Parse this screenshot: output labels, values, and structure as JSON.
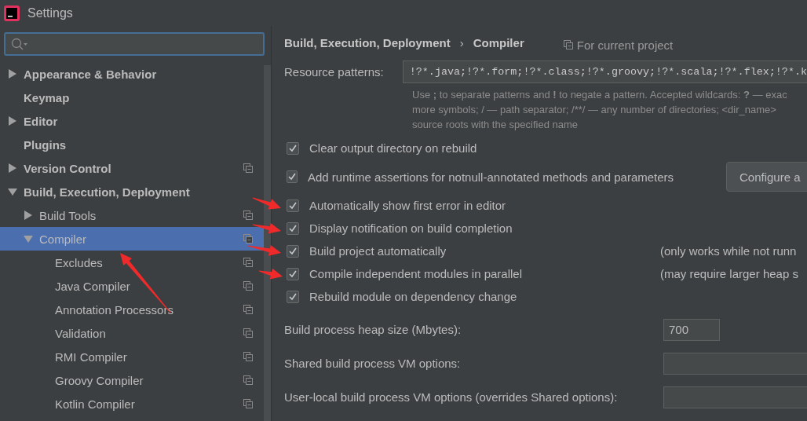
{
  "window": {
    "title": "Settings"
  },
  "tree": [
    {
      "label": "Appearance & Behavior",
      "expanded": false,
      "selected": false,
      "project_scope": false
    },
    {
      "label": "Keymap",
      "selected": false,
      "project_scope": false
    },
    {
      "label": "Editor",
      "expanded": false,
      "selected": false,
      "project_scope": false
    },
    {
      "label": "Plugins",
      "selected": false,
      "project_scope": false
    },
    {
      "label": "Version Control",
      "expanded": false,
      "selected": false,
      "project_scope": true
    },
    {
      "label": "Build, Execution, Deployment",
      "expanded": true,
      "selected": false,
      "project_scope": false,
      "children": [
        {
          "label": "Build Tools",
          "expanded": false,
          "selected": false,
          "project_scope": true
        },
        {
          "label": "Compiler",
          "expanded": true,
          "selected": true,
          "project_scope": true,
          "children": [
            {
              "label": "Excludes",
              "selected": false,
              "project_scope": true
            },
            {
              "label": "Java Compiler",
              "selected": false,
              "project_scope": true
            },
            {
              "label": "Annotation Processors",
              "selected": false,
              "project_scope": true
            },
            {
              "label": "Validation",
              "selected": false,
              "project_scope": true
            },
            {
              "label": "RMI Compiler",
              "selected": false,
              "project_scope": true
            },
            {
              "label": "Groovy Compiler",
              "selected": false,
              "project_scope": true
            },
            {
              "label": "Kotlin Compiler",
              "selected": false,
              "project_scope": true
            }
          ]
        }
      ]
    }
  ],
  "breadcrumb": {
    "items": [
      "Build, Execution, Deployment",
      "Compiler"
    ],
    "separator": "›"
  },
  "scope_note": "For current project",
  "resource_patterns": {
    "label": "Resource patterns:",
    "value": "!?*.java;!?*.form;!?*.class;!?*.groovy;!?*.scala;!?*.flex;!?*.k",
    "help": [
      "Use **;** to separate patterns and **!** to negate a pattern. Accepted wildcards: **?** — exac",
      "more symbols; / — path separator; /**/ — any number of directories;  <dir_name>",
      "source roots with the specified name"
    ]
  },
  "options": [
    {
      "label": "Clear output directory on rebuild",
      "checked": true
    },
    {
      "label": "Add runtime assertions for notnull-annotated methods and parameters",
      "checked": true,
      "button": "Configure a"
    },
    {
      "label": "Automatically show first error in editor",
      "checked": true
    },
    {
      "label": "Display notification on build completion",
      "checked": true
    },
    {
      "label": "Build project automatically",
      "checked": true,
      "note": "(only works while not runn"
    },
    {
      "label": "Compile independent modules in parallel",
      "checked": true,
      "note": "(may require larger heap s"
    },
    {
      "label": "Rebuild module on dependency change",
      "checked": true
    }
  ],
  "fields": [
    {
      "label": "Build process heap size (Mbytes):",
      "value": "700",
      "kind": "short"
    },
    {
      "label": "Shared build process VM options:",
      "kind": "wide"
    },
    {
      "label": "User-local build process VM options (overrides Shared options):",
      "kind": "wide"
    }
  ]
}
